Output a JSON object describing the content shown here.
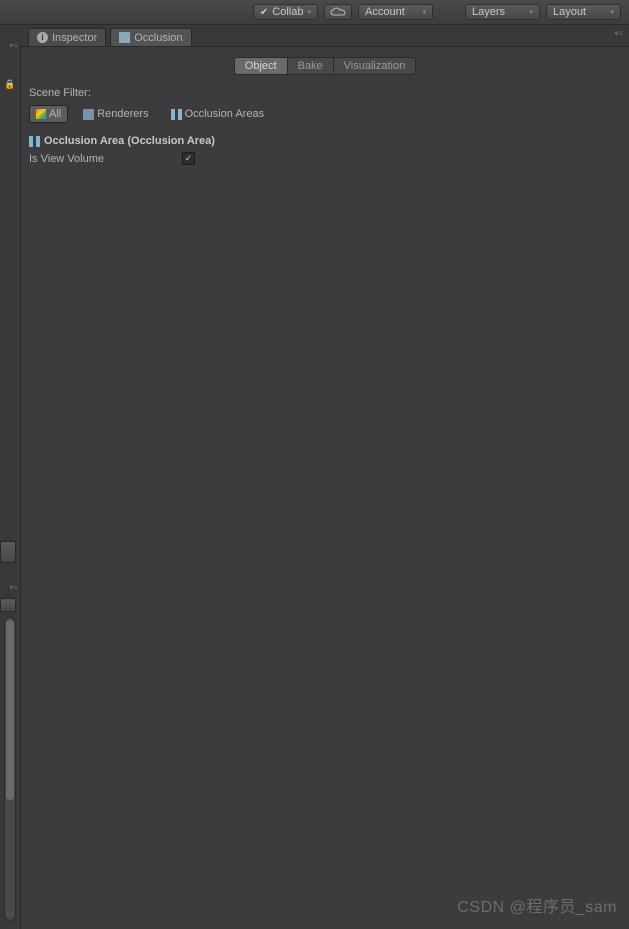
{
  "toolbar": {
    "collab": "Collab",
    "account": "Account",
    "layers": "Layers",
    "layout": "Layout"
  },
  "tabs": {
    "inspector": "Inspector",
    "occlusion": "Occlusion"
  },
  "sub_tabs": {
    "object": "Object",
    "bake": "Bake",
    "visualization": "Visualization"
  },
  "scene_filter": {
    "label": "Scene Filter:",
    "all": "All",
    "renderers": "Renderers",
    "occlusion_areas": "Occlusion Areas"
  },
  "component": {
    "title": "Occlusion Area (Occlusion Area)",
    "is_view_volume_label": "Is View Volume",
    "is_view_volume_checked": "✓"
  },
  "watermark": "CSDN @程序员_sam"
}
